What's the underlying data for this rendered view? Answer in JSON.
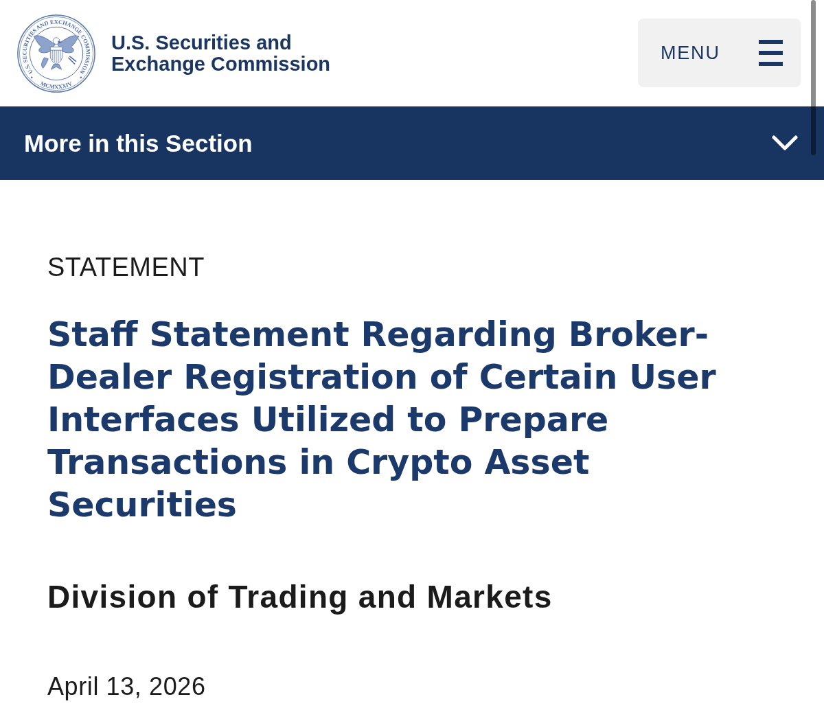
{
  "header": {
    "logo": {
      "inscription": "U.S. SECURITIES AND EXCHANGE COMMISSION",
      "year": "MCMXXXIV"
    },
    "agency_name": "U.S. Securities and Exchange Commission",
    "menu_button": {
      "label": "MENU"
    }
  },
  "section_nav": {
    "label": "More in this Section",
    "expanded": false
  },
  "article": {
    "type": "STATEMENT",
    "title": "Staff Statement Regarding Broker-Dealer Registration of Certain User Interfaces Utilized to Prepare Transactions in Crypto Asset Securities",
    "author": "Division of Trading and Markets",
    "date": "April 13, 2026"
  }
}
